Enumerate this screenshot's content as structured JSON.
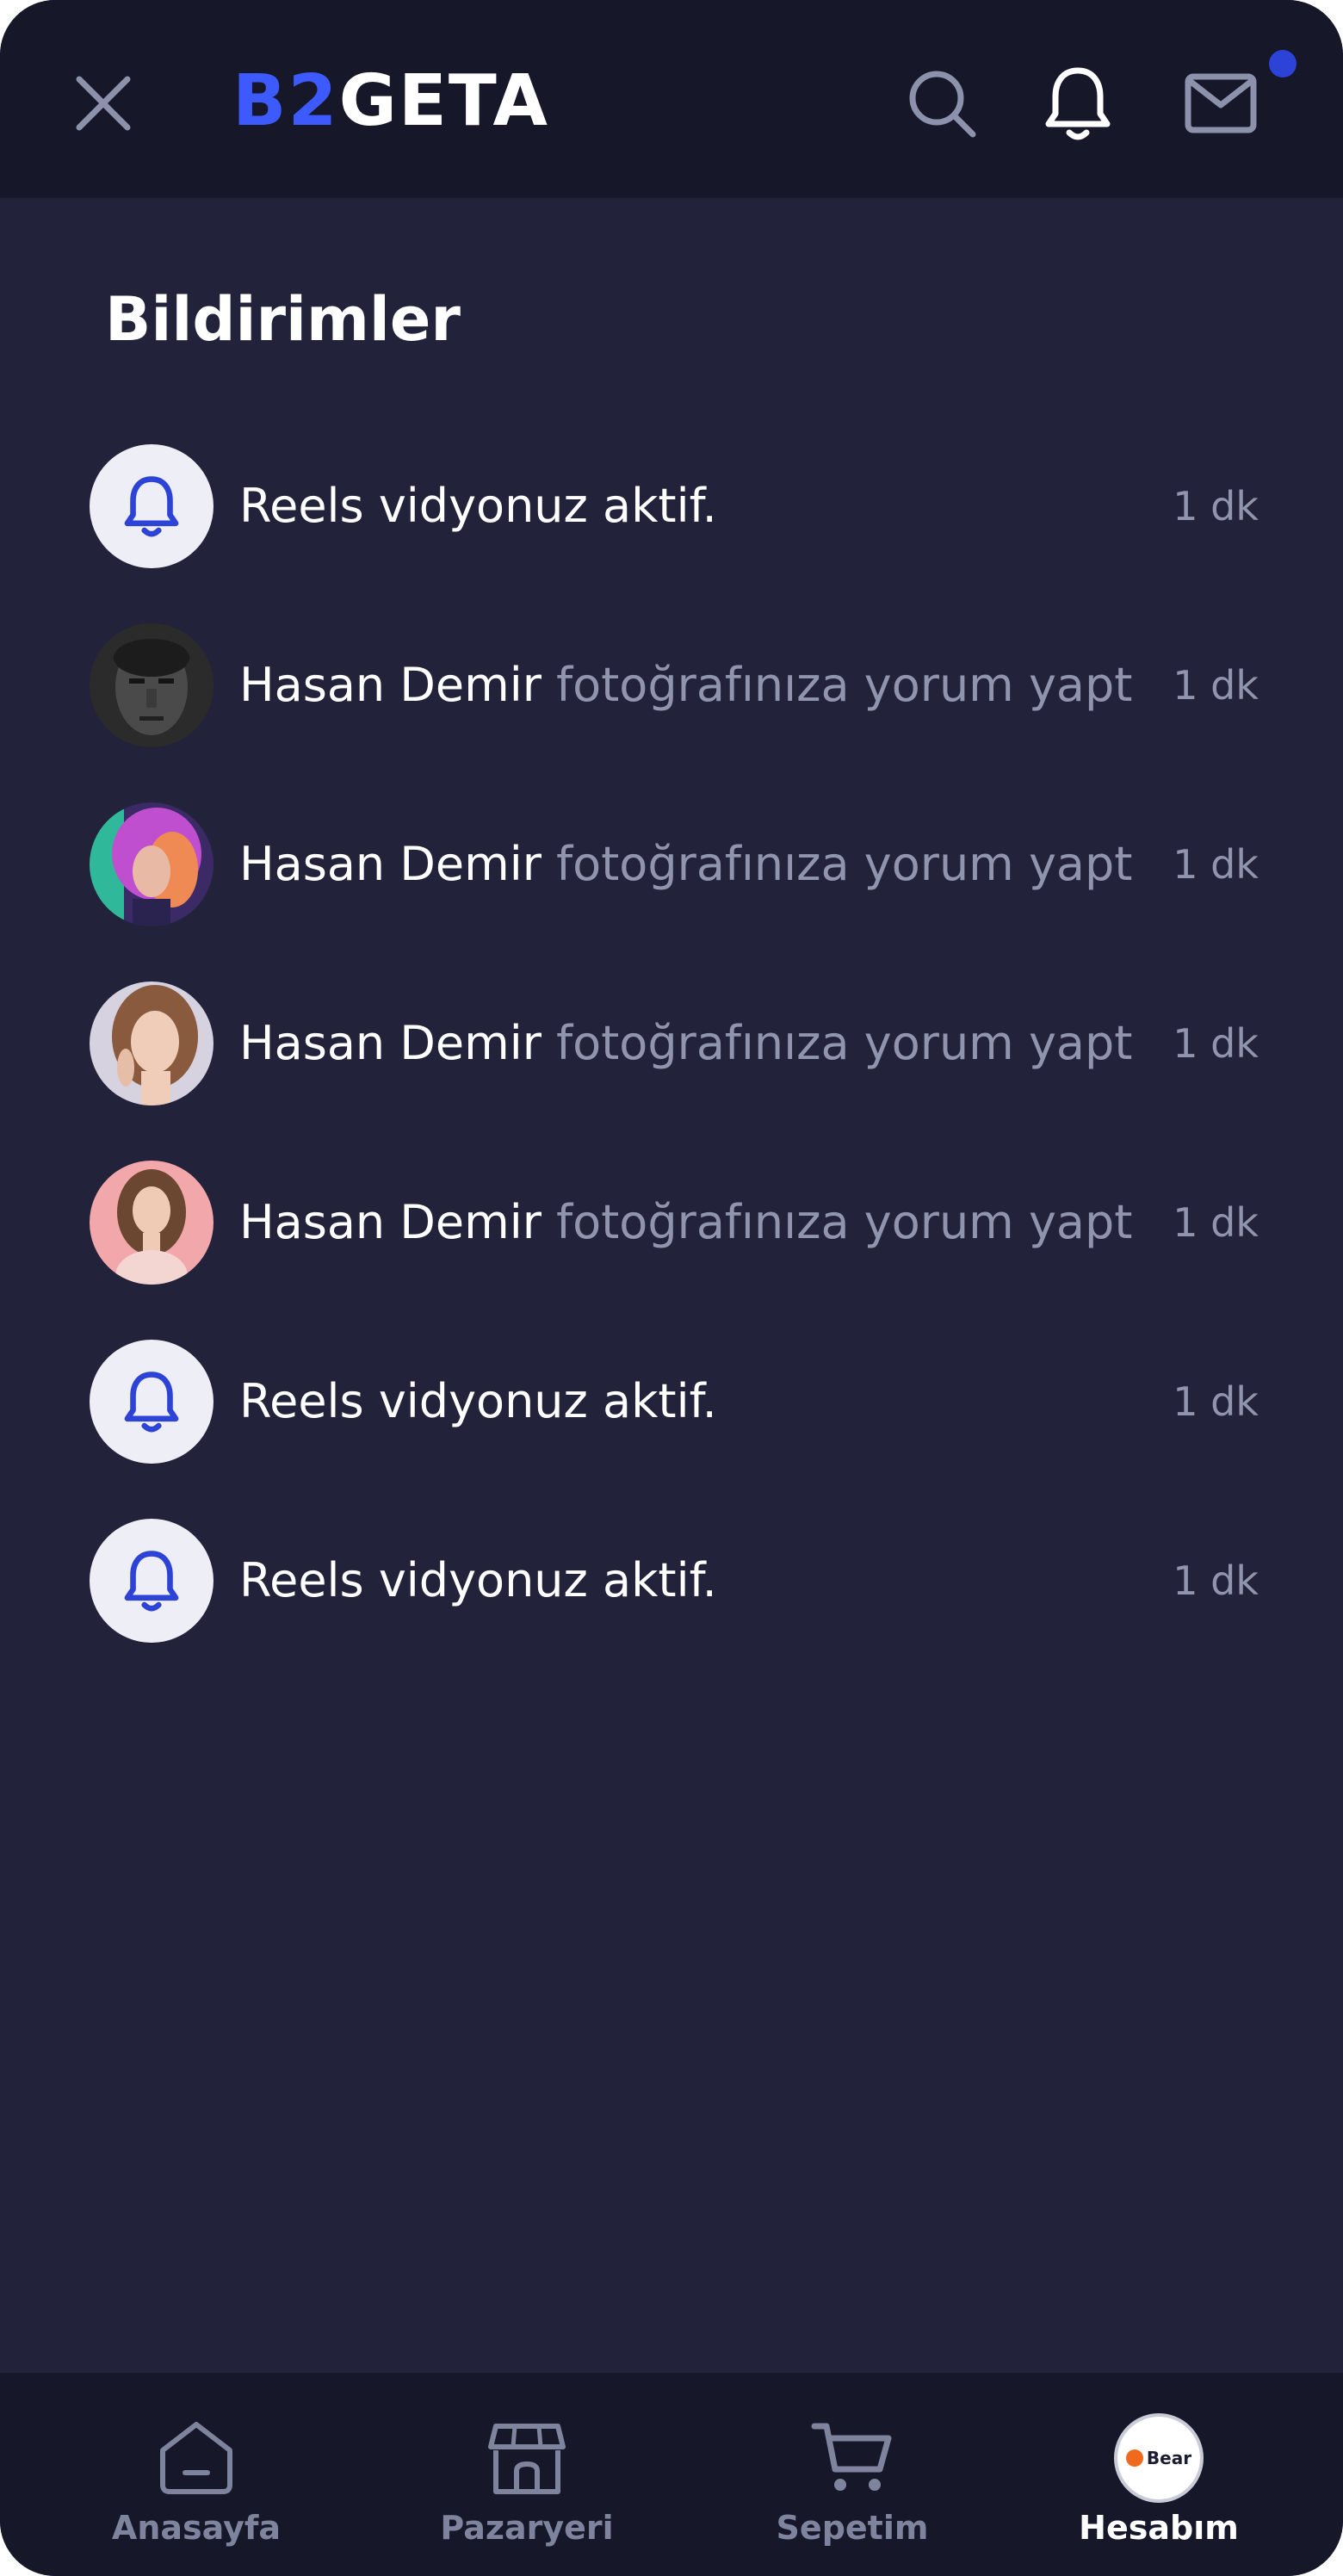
{
  "header": {
    "logo_part1": "B2",
    "logo_part2": "GETA",
    "brand_color": "#3d5afe",
    "icons": [
      "close-icon",
      "search-icon",
      "bell-icon",
      "mail-icon"
    ],
    "mail_unread_dot_color": "#2d43d8"
  },
  "page": {
    "title": "Bildirimler"
  },
  "notifications": [
    {
      "type": "system",
      "avatar": "bell-icon",
      "message": "Reels vidyonuz aktif.",
      "time": "1 dk"
    },
    {
      "type": "comment",
      "avatar": "photo",
      "actor": "Hasan Demir",
      "action": " fotoğrafınıza yorum yaptı",
      "time": "1 dk"
    },
    {
      "type": "comment",
      "avatar": "photo",
      "actor": "Hasan Demir",
      "action": " fotoğrafınıza yorum yaptı",
      "time": "1 dk"
    },
    {
      "type": "comment",
      "avatar": "photo",
      "actor": "Hasan Demir",
      "action": " fotoğrafınıza yorum yaptı",
      "time": "1 dk"
    },
    {
      "type": "comment",
      "avatar": "photo",
      "actor": "Hasan Demir",
      "action": " fotoğrafınıza yorum yaptı",
      "time": "1 dk"
    },
    {
      "type": "system",
      "avatar": "bell-icon",
      "message": "Reels vidyonuz aktif.",
      "time": "1 dk"
    },
    {
      "type": "system",
      "avatar": "bell-icon",
      "message": "Reels vidyonuz aktif.",
      "time": "1 dk"
    }
  ],
  "bottom_nav": {
    "items": [
      {
        "label": "Anasayfa",
        "icon": "home-icon",
        "active": false
      },
      {
        "label": "Pazaryeri",
        "icon": "store-icon",
        "active": false
      },
      {
        "label": "Sepetim",
        "icon": "cart-icon",
        "active": false
      },
      {
        "label": "Hesabım",
        "icon": "account-avatar",
        "active": true
      }
    ],
    "account_avatar_text": "Bear"
  }
}
